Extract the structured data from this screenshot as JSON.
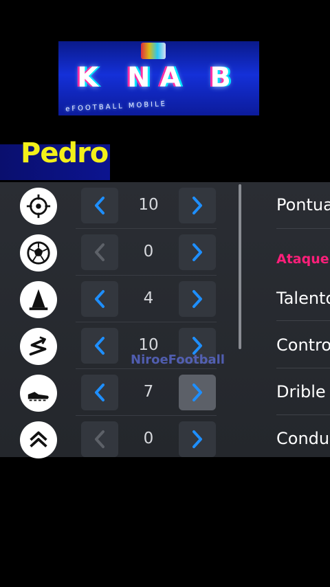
{
  "banner": {
    "logo_text": "K NA B",
    "sub_text": "eFOOTBALL MOBILE"
  },
  "player": {
    "name": "Pedro"
  },
  "controls": [
    {
      "icon": "crosshair-icon",
      "value": "10",
      "dec_enabled": true,
      "inc_enabled": true,
      "inc_highlight": false
    },
    {
      "icon": "soccer-ball-icon",
      "value": "0",
      "dec_enabled": false,
      "inc_enabled": true,
      "inc_highlight": false
    },
    {
      "icon": "cone-icon",
      "value": "4",
      "dec_enabled": true,
      "inc_enabled": true,
      "inc_highlight": false
    },
    {
      "icon": "zigzag-arrow-icon",
      "value": "10",
      "dec_enabled": true,
      "inc_enabled": true,
      "inc_highlight": false
    },
    {
      "icon": "boot-icon",
      "value": "7",
      "dec_enabled": true,
      "inc_enabled": true,
      "inc_highlight": true
    },
    {
      "icon": "double-chevron-up-icon",
      "value": "0",
      "dec_enabled": false,
      "inc_enabled": true,
      "inc_highlight": false
    }
  ],
  "right_panel": {
    "pontuacao": "Pontua",
    "section": "Ataque",
    "talento": "Talento",
    "controle": "Contro",
    "drible": "Drible",
    "conducao": "Condu"
  },
  "watermark": "NiroeFootball",
  "colors": {
    "accent_blue": "#1e8fff",
    "name_yellow": "#f3f01a",
    "section_pink": "#ff1f7a"
  }
}
